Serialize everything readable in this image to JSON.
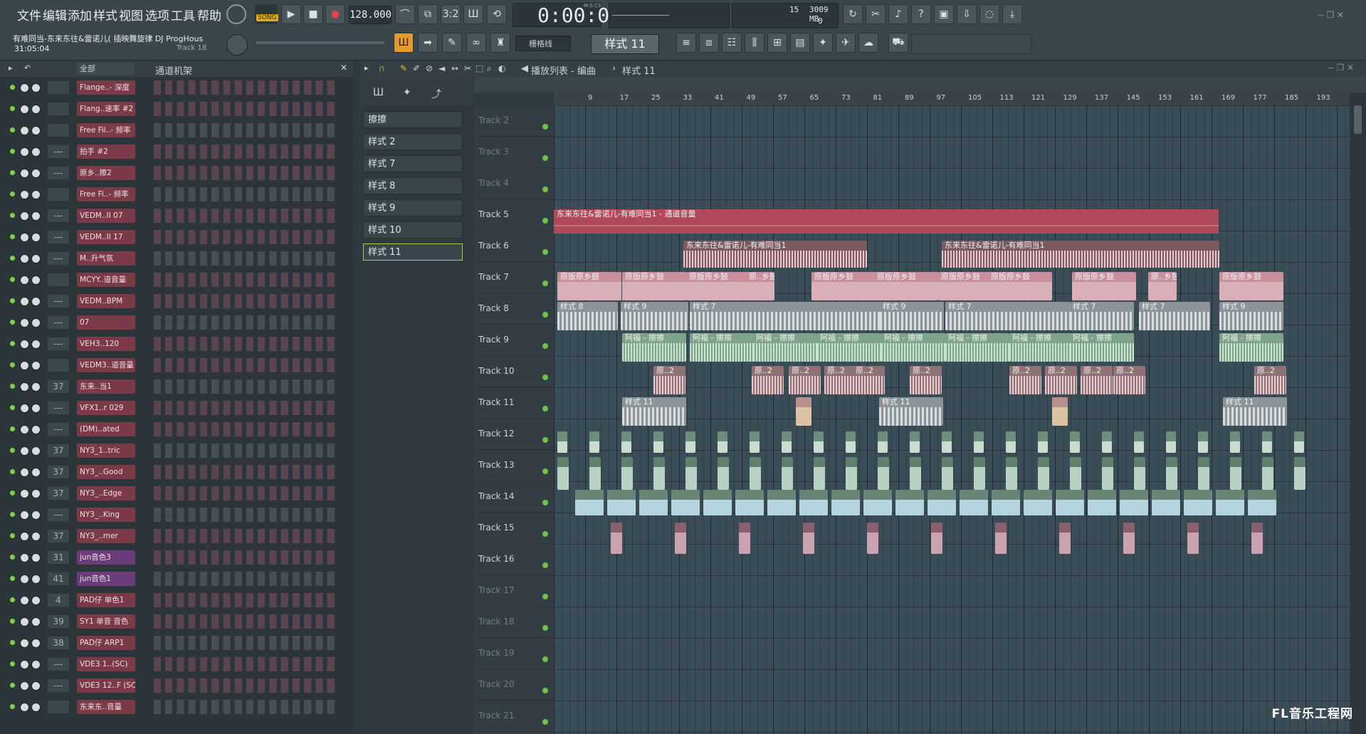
{
  "menu": [
    "文件",
    "编辑",
    "添加",
    "样式",
    "视图",
    "选项",
    "工具",
    "帮助"
  ],
  "transport": {
    "mode_label": "SONG",
    "tempo": "128.000",
    "time": "0:00:00",
    "time_unit": "M:S:CS",
    "cpu_value": "15",
    "memory": "3009 MB",
    "poly": "0"
  },
  "project": {
    "title": "有难同当-东来东往&雷诺儿( 插映舞旋律 DJ ProgHous",
    "time": "31:05:04",
    "hint": "Track 18"
  },
  "snap": {
    "label": "栅格线"
  },
  "pattern": {
    "label": "样式 11"
  },
  "rack": {
    "filter": "全部",
    "title": "通道机架",
    "channels": [
      {
        "num": "",
        "name": "Flange..- 深度"
      },
      {
        "num": "",
        "name": "Flang..速率 #2"
      },
      {
        "num": "",
        "name": "Free Fil..- 频率"
      },
      {
        "num": "---",
        "name": "拍手 #2"
      },
      {
        "num": "---",
        "name": "原乡..擦2"
      },
      {
        "num": "",
        "name": "Free Fi..- 频率"
      },
      {
        "num": "---",
        "name": "VEDM..II 07"
      },
      {
        "num": "---",
        "name": "VEDM..II 17"
      },
      {
        "num": "---",
        "name": "M..升气氛"
      },
      {
        "num": "",
        "name": "MCYY..道音量"
      },
      {
        "num": "---",
        "name": "VEDM..BPM"
      },
      {
        "num": "---",
        "name": "07"
      },
      {
        "num": "---",
        "name": "VEH3..120"
      },
      {
        "num": "",
        "name": "VEDM3..道音量"
      },
      {
        "num": "37",
        "name": "东来..当1"
      },
      {
        "num": "---",
        "name": "VFX1..r 029"
      },
      {
        "num": "---",
        "name": "(DM)..ated"
      },
      {
        "num": "37",
        "name": "NY3_1..tric"
      },
      {
        "num": "37",
        "name": "NY3_..Good"
      },
      {
        "num": "37",
        "name": "NY3_..Edge"
      },
      {
        "num": "---",
        "name": "NY3_..King"
      },
      {
        "num": "37",
        "name": "NY3_..mer"
      },
      {
        "num": "31",
        "name": "jun音色3"
      },
      {
        "num": "41",
        "name": "jun音色1"
      },
      {
        "num": "4",
        "name": "PAD仔 单色1"
      },
      {
        "num": "39",
        "name": "SY1 单音 音色"
      },
      {
        "num": "38",
        "name": "PAD仔 ARP1"
      },
      {
        "num": "---",
        "name": "VDE3 1..(SC)"
      },
      {
        "num": "---",
        "name": "VDE3 12..F (SC)"
      },
      {
        "num": "",
        "name": "东来东..音量"
      }
    ]
  },
  "picker": {
    "items": [
      "擦擦",
      "样式 2",
      "样式 7",
      "样式 8",
      "样式 9",
      "样式 10",
      "样式 11"
    ]
  },
  "playlist": {
    "title": "播放列表 - 编曲",
    "breadcrumb_sep": "›",
    "pattern": "样式 11",
    "ruler": [
      "9",
      "17",
      "25",
      "33",
      "41",
      "49",
      "57",
      "65",
      "73",
      "81",
      "89",
      "97",
      "105",
      "113",
      "121",
      "129",
      "137",
      "145",
      "153",
      "161",
      "169",
      "177",
      "185",
      "193"
    ],
    "tracks": [
      "Track 2",
      "Track 3",
      "Track 4",
      "Track 5",
      "Track 6",
      "Track 7",
      "Track 8",
      "Track 9",
      "Track 10",
      "Track 11",
      "Track 12",
      "Track 13",
      "Track 14",
      "Track 15",
      "Track 16",
      "Track 17",
      "Track 18",
      "Track 19",
      "Track 20",
      "Track 21"
    ],
    "clips": {
      "automation": "东来东往&雷诺儿-有难同当1 - 通道音量",
      "audio": "东来东往&雷诺儿-有难同当1",
      "drums": "原版原乡鼓",
      "drums_short": "原..乡鼓",
      "p8": "样式 8",
      "p9": "样式 9",
      "p7": "样式 7",
      "afu": "阿福 - 擦擦",
      "yuan2": "原..2",
      "p11": "样式 11"
    }
  },
  "watermark": "FL音乐工程网",
  "colors": {
    "clip_red": "#b04a58",
    "clip_pink": "#c98f9a",
    "clip_green": "#7fa38a",
    "clip_grey": "#8c9499",
    "grid": "#3a4c56"
  }
}
